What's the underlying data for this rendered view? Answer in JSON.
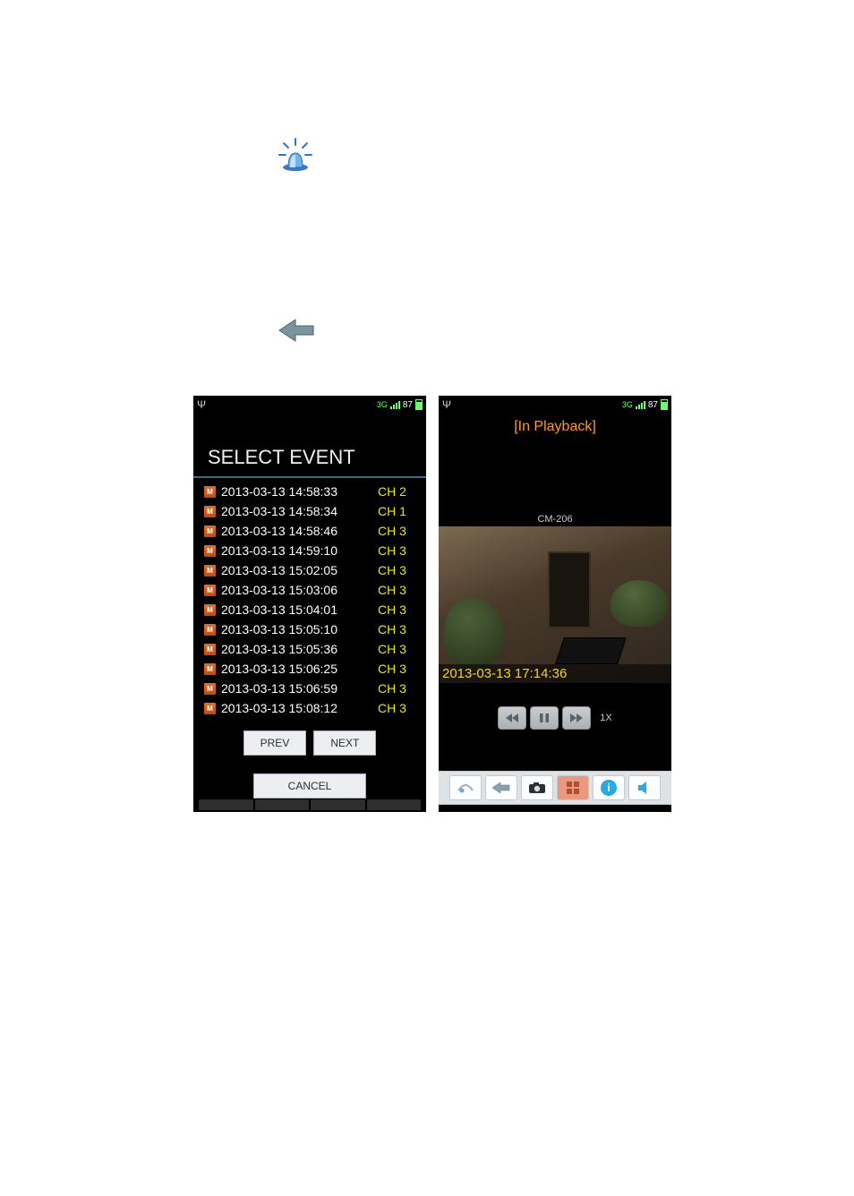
{
  "status_bar": {
    "battery": "87"
  },
  "icons": {
    "alarm_name": "alarm-icon",
    "back_name": "back-icon"
  },
  "left_panel": {
    "heading": "SELECT EVENT",
    "events": [
      {
        "time": "2013-03-13 14:58:33",
        "ch": "CH 2"
      },
      {
        "time": "2013-03-13 14:58:34",
        "ch": "CH 1"
      },
      {
        "time": "2013-03-13 14:58:46",
        "ch": "CH 3"
      },
      {
        "time": "2013-03-13 14:59:10",
        "ch": "CH 3"
      },
      {
        "time": "2013-03-13 15:02:05",
        "ch": "CH 3"
      },
      {
        "time": "2013-03-13 15:03:06",
        "ch": "CH 3"
      },
      {
        "time": "2013-03-13 15:04:01",
        "ch": "CH 3"
      },
      {
        "time": "2013-03-13 15:05:10",
        "ch": "CH 3"
      },
      {
        "time": "2013-03-13 15:05:36",
        "ch": "CH 3"
      },
      {
        "time": "2013-03-13 15:06:25",
        "ch": "CH 3"
      },
      {
        "time": "2013-03-13 15:06:59",
        "ch": "CH 3"
      },
      {
        "time": "2013-03-13 15:08:12",
        "ch": "CH 3"
      }
    ],
    "prev": "PREV",
    "next": "NEXT",
    "cancel": "CANCEL"
  },
  "right_panel": {
    "mode_label": "[In Playback]",
    "camera_name": "CM-206",
    "timestamp": "2013-03-13 17:14:36",
    "speed": "1X"
  }
}
